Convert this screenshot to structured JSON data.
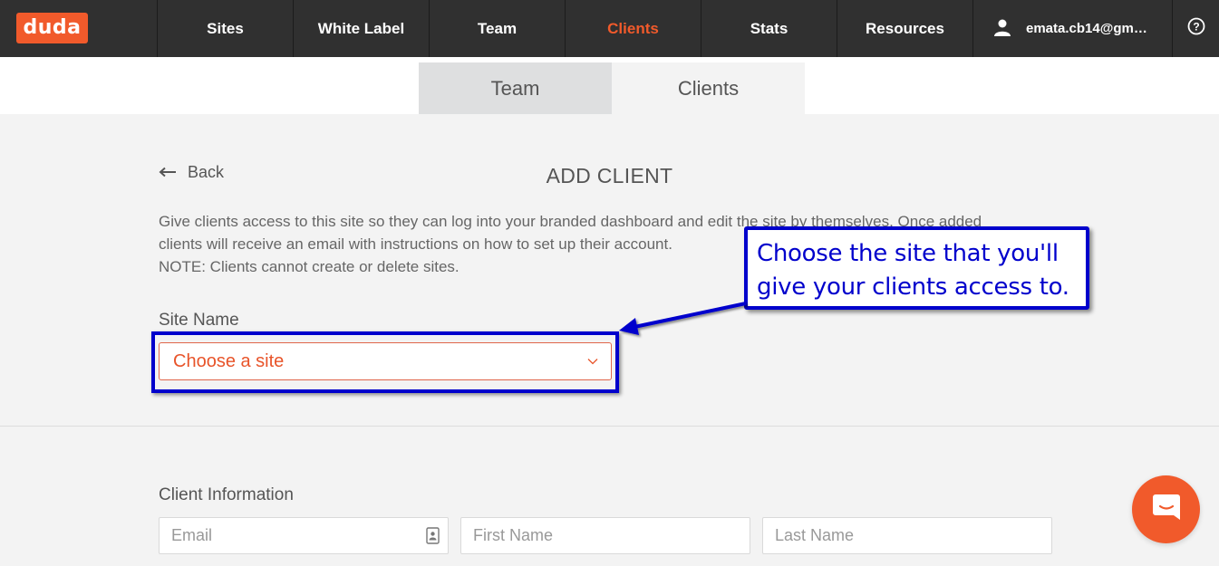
{
  "brand": {
    "logo_text": "duda",
    "accent_color": "#f15a2b",
    "annotation_color": "#0000cc"
  },
  "nav": {
    "items": [
      {
        "label": "Sites"
      },
      {
        "label": "White Label"
      },
      {
        "label": "Team"
      },
      {
        "label": "Clients",
        "active": true
      },
      {
        "label": "Stats"
      },
      {
        "label": "Resources"
      }
    ],
    "user_email": "emata.cb14@gm…",
    "user_icon": "user-icon",
    "help_icon": "help-circle-icon"
  },
  "subtabs": {
    "team": "Team",
    "clients": "Clients",
    "active": "Clients"
  },
  "page": {
    "back_label": "Back",
    "title": "ADD CLIENT",
    "description_line1": "Give clients access to this site so they can log into your branded dashboard and edit the site by themselves. Once added",
    "description_line2": "clients will receive an email with instructions on how to set up their account.",
    "note": "NOTE: Clients cannot create or delete sites.",
    "site_name_label": "Site Name",
    "site_select_value": "Choose a site",
    "client_info_label": "Client Information",
    "email_placeholder": "Email",
    "first_name_placeholder": "First Name",
    "last_name_placeholder": "Last Name"
  },
  "annotation": {
    "line1": "Choose the site that you'll",
    "line2": "give your clients access to."
  },
  "chat_icon": "chat-bubble-icon"
}
